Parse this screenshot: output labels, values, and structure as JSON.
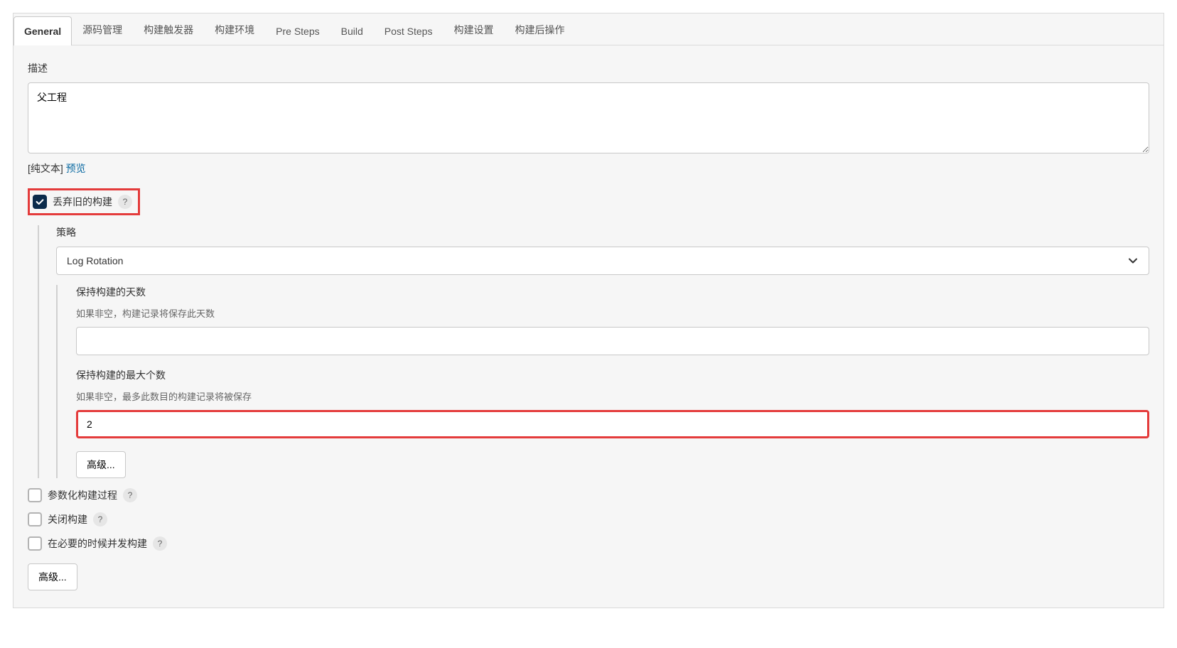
{
  "tabs": [
    "General",
    "源码管理",
    "构建触发器",
    "构建环境",
    "Pre Steps",
    "Build",
    "Post Steps",
    "构建设置",
    "构建后操作"
  ],
  "active_tab_index": 0,
  "description": {
    "label": "描述",
    "value": "父工程",
    "plain_prefix": "[纯文本] ",
    "preview_link": "预览"
  },
  "discard": {
    "checkbox_label": "丢弃旧的构建",
    "help": "?",
    "checked": true,
    "strategy": {
      "label": "策略",
      "selected": "Log Rotation",
      "days": {
        "label": "保持构建的天数",
        "help_text": "如果非空，构建记录将保存此天数",
        "value": ""
      },
      "max": {
        "label": "保持构建的最大个数",
        "help_text": "如果非空，最多此数目的构建记录将被保存",
        "value": "2"
      },
      "advanced_button": "高级..."
    }
  },
  "options": {
    "param_build": {
      "label": "参数化构建过程",
      "help": "?",
      "checked": false
    },
    "disable_build": {
      "label": "关闭构建",
      "help": "?",
      "checked": false
    },
    "concurrent_build": {
      "label": "在必要的时候并发构建",
      "help": "?",
      "checked": false
    }
  },
  "bottom_advanced_button": "高级..."
}
